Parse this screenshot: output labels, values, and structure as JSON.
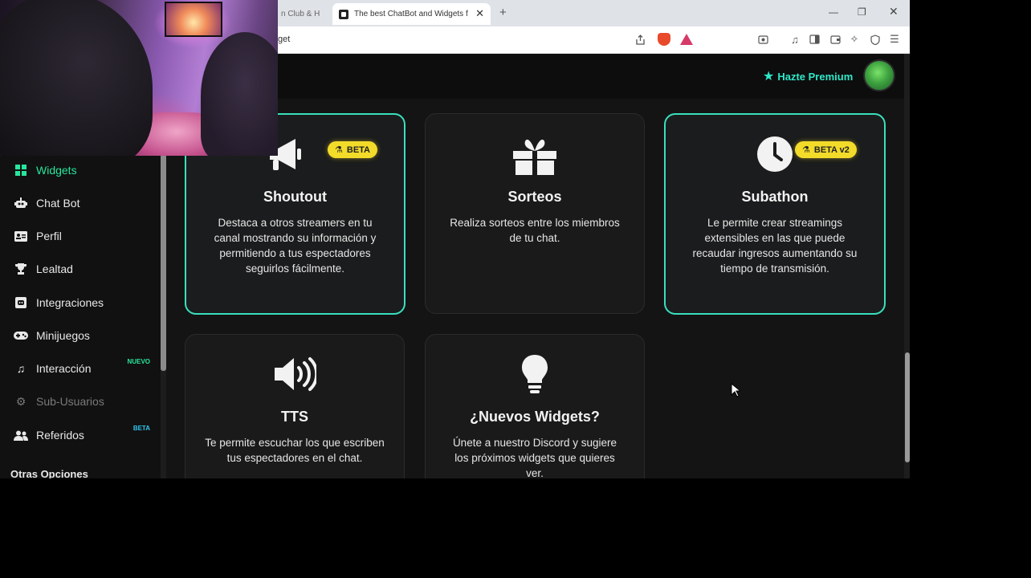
{
  "browser": {
    "inactive_tab_label": "n Club & H",
    "active_tab_label": "The best ChatBot and Widgets f",
    "tab_close": "✕",
    "new_tab": "+",
    "url": "get",
    "window_controls": {
      "minimize": "—",
      "maximize": "❐",
      "close": "✕"
    }
  },
  "topbar": {
    "premium_label": "Hazte Premium",
    "premium_icon": "star-icon",
    "accent_color": "#2ee8c8"
  },
  "sidebar": {
    "items": [
      {
        "label": "Widgets",
        "icon": "grid-icon",
        "state": "active"
      },
      {
        "label": "Chat Bot",
        "icon": "robot-icon",
        "state": "normal"
      },
      {
        "label": "Perfil",
        "icon": "id-card-icon",
        "state": "normal"
      },
      {
        "label": "Lealtad",
        "icon": "trophy-icon",
        "state": "normal"
      },
      {
        "label": "Integraciones",
        "icon": "discord-icon",
        "state": "normal"
      },
      {
        "label": "Minijuegos",
        "icon": "gamepad-icon",
        "state": "normal"
      },
      {
        "label": "Interacción",
        "icon": "music-icon",
        "state": "normal",
        "badge": "NUEVO"
      },
      {
        "label": "Sub-Usuarios",
        "icon": "gears-icon",
        "state": "disabled"
      },
      {
        "label": "Referidos",
        "icon": "users-icon",
        "state": "normal",
        "badge": "BETA"
      }
    ],
    "section_title": "Otras Opciones",
    "active_color": "#27e69e"
  },
  "cards": [
    {
      "title": "Shoutout",
      "icon": "megaphone-icon",
      "badge": "BETA",
      "highlight": true,
      "description": "Destaca a otros streamers en tu canal mostrando su información y permitiendo a tus espectadores seguirlos fácilmente."
    },
    {
      "title": "Sorteos",
      "icon": "gift-icon",
      "highlight": false,
      "description": "Realiza sorteos entre los miembros de tu chat."
    },
    {
      "title": "Subathon",
      "icon": "clock-icon",
      "badge": "BETA v2",
      "highlight": true,
      "description": "Le permite crear streamings extensibles en las que puede recaudar ingresos aumentando su tiempo de transmisión."
    },
    {
      "title": "TTS",
      "icon": "speaker-icon",
      "highlight": false,
      "description": "Te permite escuchar los que escriben tus espectadores en el chat."
    },
    {
      "title": "¿Nuevos Widgets?",
      "icon": "lightbulb-icon",
      "highlight": false,
      "description": "Únete a nuestro Discord y sugiere los próximos widgets que quieres ver."
    }
  ],
  "colors": {
    "card_border_highlight": "#39e0bd",
    "beta_badge": "#f3db2a"
  }
}
